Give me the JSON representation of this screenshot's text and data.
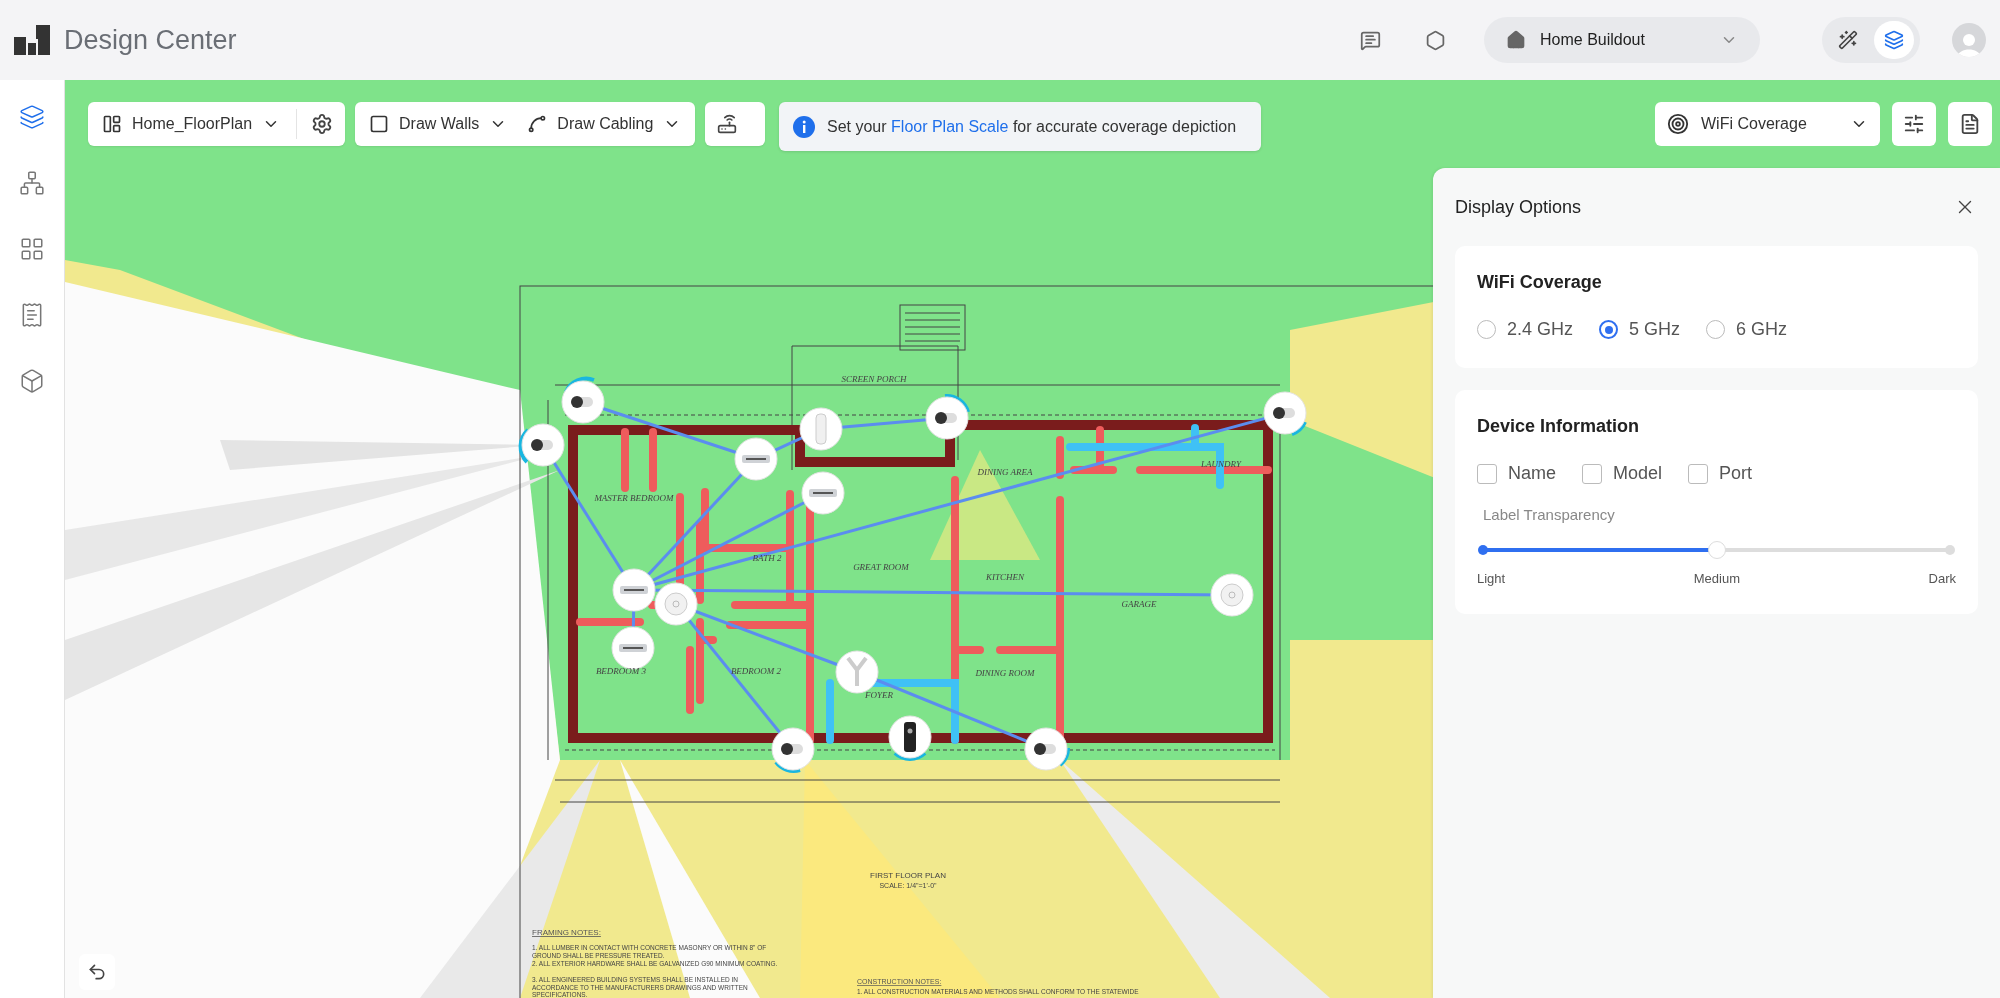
{
  "app": {
    "title": "Design Center"
  },
  "project": {
    "name": "Home Buildout"
  },
  "view_toggle": [
    {
      "kind": "wand",
      "selected": false
    },
    {
      "kind": "layers",
      "selected": true
    }
  ],
  "sidebar": {
    "items": [
      {
        "kind": "layers",
        "selected": true
      },
      {
        "kind": "network",
        "selected": false
      },
      {
        "kind": "grid",
        "selected": false
      },
      {
        "kind": "receipt",
        "selected": false
      },
      {
        "kind": "cube",
        "selected": false
      }
    ]
  },
  "toolbar": {
    "floor_plan": "Home_FloorPlan",
    "draw_walls": "Draw Walls",
    "draw_cabling": "Draw Cabling",
    "coverage": "WiFi Coverage"
  },
  "notice": {
    "before": "Set your",
    "link": "Floor Plan Scale",
    "after": "for accurate coverage depiction"
  },
  "plan": {
    "rooms": [
      "SCREEN PORCH",
      "MASTER BEDROOM",
      "BATH 2",
      "GREAT ROOM",
      "DINING AREA",
      "KITCHEN",
      "LAUNDRY",
      "GARAGE",
      "BEDROOM 3",
      "BEDROOM 2",
      "FOYER",
      "DINING ROOM"
    ],
    "title": "FIRST FLOOR PLAN",
    "scale": "SCALE: 1/4\"=1'-0\"",
    "framing_notes": {
      "title": "FRAMING NOTES:",
      "items": [
        "1. ALL LUMBER IN CONTACT WITH CONCRETE MASONRY OR WITHIN 8\" OF GROUND SHALL BE PRESSURE TREATED.",
        "2. ALL EXTERIOR HARDWARE SHALL BE GALVANIZED G90 MINIMUM COATING.",
        "3. ALL ENGINEERED BUILDING SYSTEMS SHALL BE INSTALLED IN ACCORDANCE TO THE MANUFACTURERS DRAWINGS AND WRITTEN SPECIFICATIONS."
      ]
    },
    "construction_notes": {
      "title": "CONSTRUCTION NOTES:",
      "items": [
        "1. ALL CONSTRUCTION MATERIALS AND METHODS SHALL CONFORM TO THE STATEWIDE"
      ]
    }
  },
  "display_options": {
    "title": "Display Options",
    "wifi_coverage": {
      "title": "WiFi Coverage",
      "options": [
        {
          "label": "2.4 GHz",
          "selected": false
        },
        {
          "label": "5 GHz",
          "selected": true
        },
        {
          "label": "6 GHz",
          "selected": false
        }
      ]
    },
    "device_information": {
      "title": "Device Information",
      "options": [
        {
          "label": "Name",
          "checked": false
        },
        {
          "label": "Model",
          "checked": false
        },
        {
          "label": "Port",
          "checked": false
        }
      ],
      "label_transparency": {
        "label": "Label Transparency",
        "level": 0.5,
        "stops": [
          "Light",
          "Medium",
          "Dark"
        ]
      }
    }
  }
}
